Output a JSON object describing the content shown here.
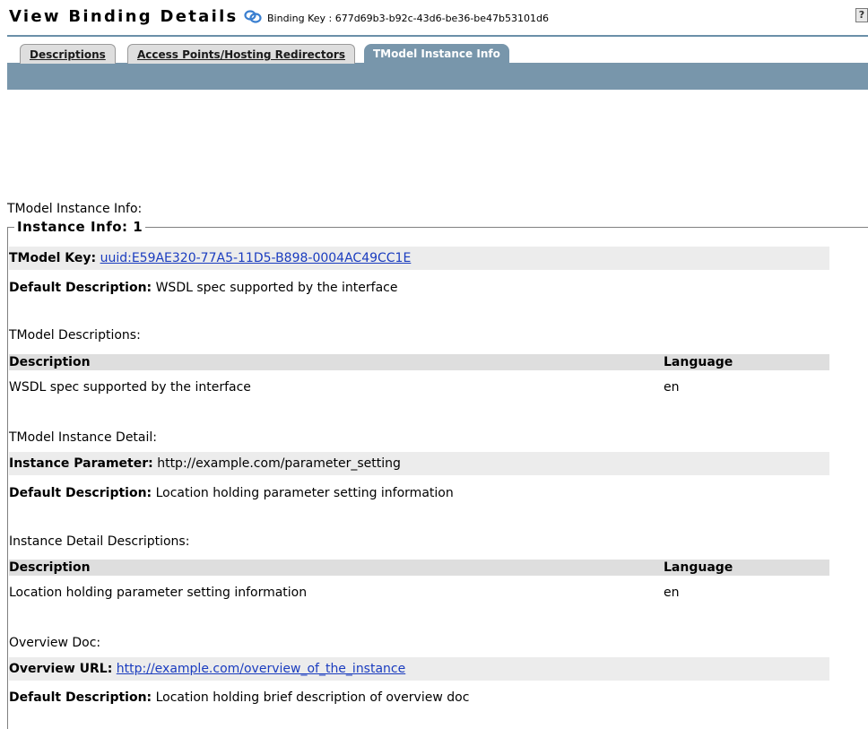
{
  "header": {
    "title": "View Binding Details",
    "binding_key_label": "Binding Key : 677d69b3-b92c-43d6-be36-be47b53101d6",
    "help_glyph": "?"
  },
  "tabs": [
    {
      "label": "Descriptions",
      "active": false
    },
    {
      "label": "Access Points/Hosting Redirectors",
      "active": false
    },
    {
      "label": "TModel Instance Info",
      "active": true
    }
  ],
  "main": {
    "section_label": "TModel Instance Info:",
    "legend": "Instance Info: 1",
    "tmodel_key": {
      "label": "TModel Key:",
      "value": "uuid:E59AE320-77A5-11D5-B898-0004AC49CC1E"
    },
    "default_description": {
      "label": "Default Description:",
      "value": "WSDL spec supported by the interface"
    },
    "tmodel_descriptions": {
      "label": "TModel Descriptions:",
      "columns": [
        "Description",
        "Language"
      ],
      "rows": [
        [
          "WSDL spec supported by the interface",
          "en"
        ]
      ]
    },
    "instance_detail": {
      "label": "TModel Instance Detail:",
      "parameter": {
        "label": "Instance Parameter:",
        "value": "http://example.com/parameter_setting"
      },
      "default_description": {
        "label": "Default Description:",
        "value": "Location holding parameter setting information"
      }
    },
    "instance_detail_descriptions": {
      "label": "Instance Detail Descriptions:",
      "columns": [
        "Description",
        "Language"
      ],
      "rows": [
        [
          "Location holding parameter setting information",
          "en"
        ]
      ]
    },
    "overview_doc": {
      "label": "Overview Doc:",
      "url": {
        "label": "Overview URL:",
        "value": "http://example.com/overview_of_the_instance"
      },
      "default_description": {
        "label": "Default Description:",
        "value": "Location holding brief description of overview doc"
      }
    }
  },
  "colors": {
    "tab_bar": "#7896ab",
    "link": "#1a3cbf",
    "shade": "#ececec"
  }
}
